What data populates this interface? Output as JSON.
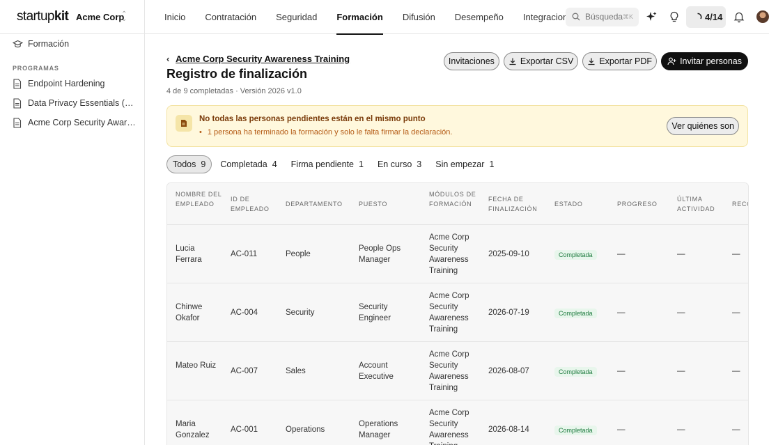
{
  "brand": {
    "logo_a": "startup",
    "logo_b": "kit",
    "org": "Acme Corp"
  },
  "nav": [
    "Inicio",
    "Contratación",
    "Seguridad",
    "Formación",
    "Difusión",
    "Desempeño",
    "Integraciones"
  ],
  "search": {
    "placeholder": "Búsqueda",
    "shortcut": "⌘K"
  },
  "progress": "4/14",
  "sidebar": {
    "top_item": "Formación",
    "section": "PROGRAMAS",
    "programs": [
      "Endpoint Hardening",
      "Data Privacy Essentials (GD…",
      "Acme Corp Security Awaren…"
    ]
  },
  "page": {
    "breadcrumb": "Acme Corp Security Awareness Training",
    "title": "Registro de finalización",
    "subtitle": "4 de 9 completadas · Versión 2026 v1.0"
  },
  "actions": {
    "invitations": "Invitaciones",
    "export_csv": "Exportar CSV",
    "export_pdf": "Exportar PDF",
    "invite": "Invitar personas"
  },
  "alert": {
    "title": "No todas las personas pendientes están en el mismo punto",
    "line": "1 persona ha terminado la formación y solo le falta firmar la declaración.",
    "button": "Ver quiénes son"
  },
  "filters": [
    {
      "label": "Todos",
      "count": "9"
    },
    {
      "label": "Completada",
      "count": "4"
    },
    {
      "label": "Firma pendiente",
      "count": "1"
    },
    {
      "label": "En curso",
      "count": "3"
    },
    {
      "label": "Sin empezar",
      "count": "1"
    }
  ],
  "table": {
    "headers": [
      "NOMBRE DEL EMPLEADO",
      "ID DE EMPLEADO",
      "DEPARTAMENTO",
      "PUESTO",
      "MÓDULOS DE FORMACIÓN",
      "FECHA DE FINALIZACIÓN",
      "ESTADO",
      "PROGRESO",
      "ÚLTIMA ACTIVIDAD",
      "RECO"
    ],
    "rows": [
      {
        "name": "Lucia Ferrara",
        "id": "AC-011",
        "dept": "People",
        "role": "People Ops Manager",
        "module": "Acme Corp Security Awareness Training",
        "date": "2025-09-10",
        "status": "Completada",
        "progress": "—",
        "activity": "—",
        "rec": "—"
      },
      {
        "name": "Chinwe Okafor",
        "id": "AC-004",
        "dept": "Security",
        "role": "Security Engineer",
        "module": "Acme Corp Security Awareness Training",
        "date": "2026-07-19",
        "status": "Completada",
        "progress": "—",
        "activity": "—",
        "rec": "—"
      },
      {
        "name": "Mateo Ruiz",
        "id": "AC-007",
        "dept": "Sales",
        "role": "Account Executive",
        "module": "Acme Corp Security Awareness Training",
        "date": "2026-08-07",
        "status": "Completada",
        "progress": "—",
        "activity": "—",
        "rec": "—"
      },
      {
        "name": "Maria Gonzalez",
        "id": "AC-001",
        "dept": "Operations",
        "role": "Operations Manager",
        "module": "Acme Corp Security Awareness Training",
        "date": "2026-08-14",
        "status": "Completada",
        "progress": "—",
        "activity": "—",
        "rec": "—"
      }
    ]
  }
}
